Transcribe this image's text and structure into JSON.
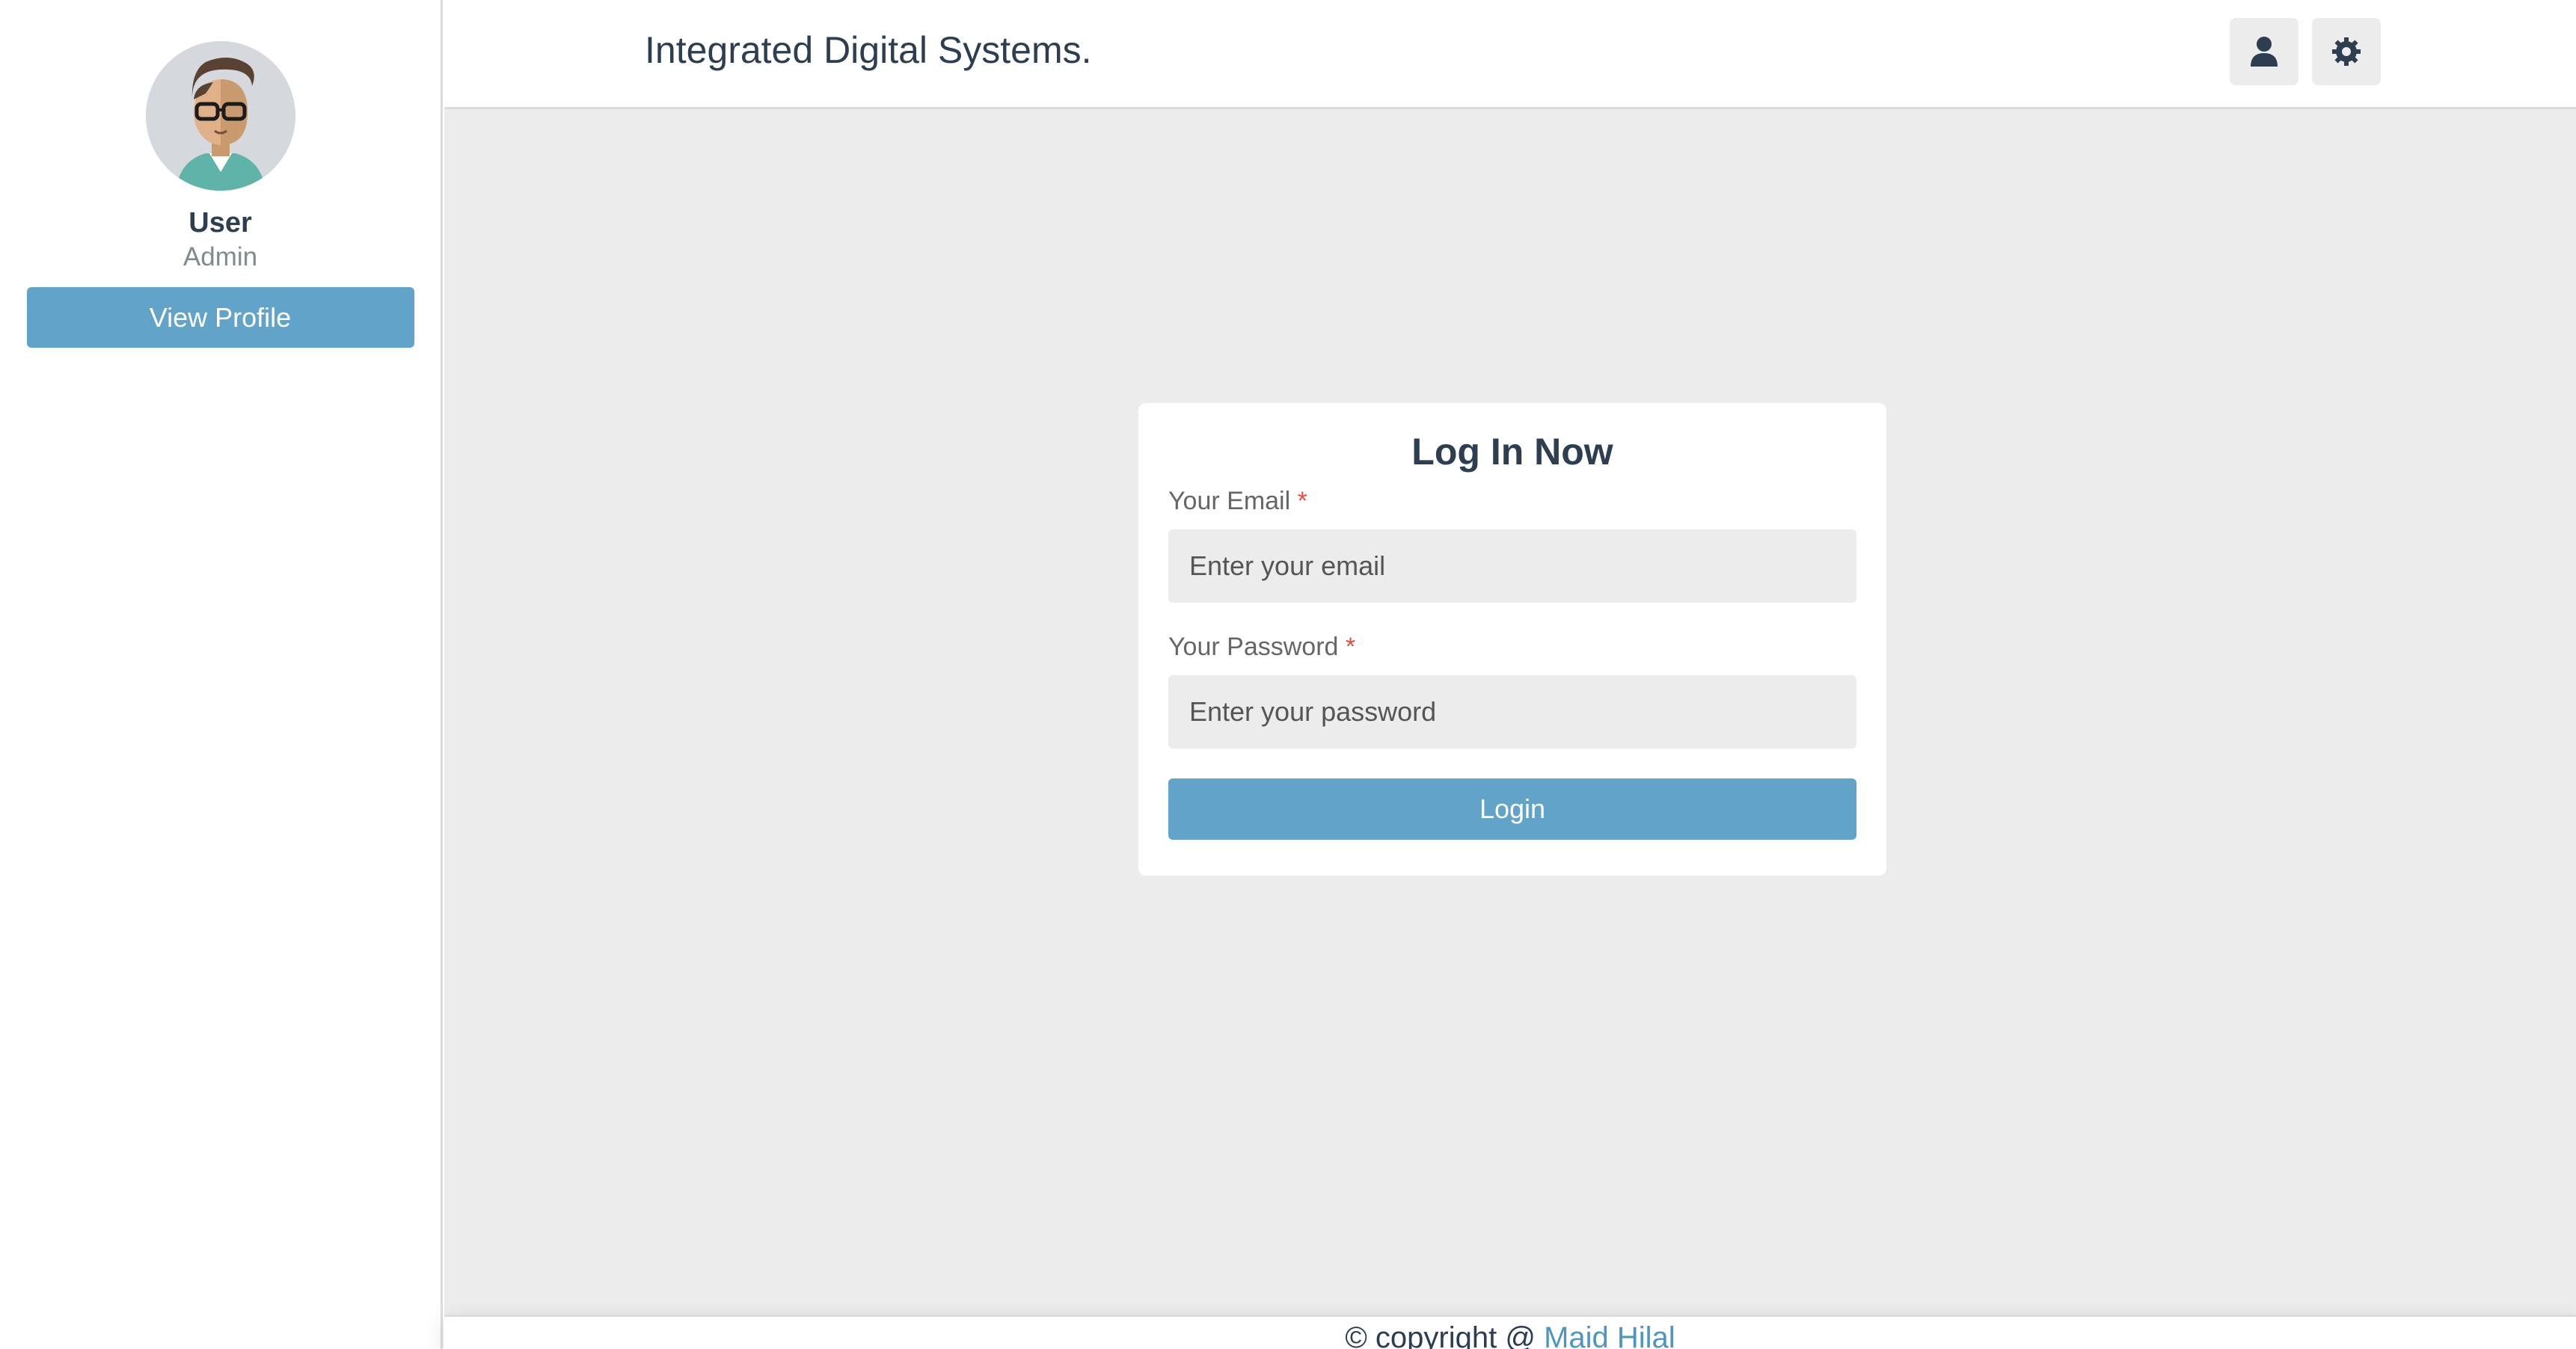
{
  "sidebar": {
    "profile": {
      "name": "User",
      "role": "Admin",
      "view_profile_label": "View Profile"
    }
  },
  "header": {
    "brand": "Integrated Digital Systems.",
    "icons": [
      "user-icon",
      "gear-icon"
    ]
  },
  "login": {
    "title": "Log In Now",
    "email_label": "Your Email",
    "email_placeholder": "Enter your email",
    "password_label": "Your Password",
    "password_placeholder": "Enter your password",
    "required_mark": "*",
    "submit_label": "Login"
  },
  "footer": {
    "copyright_text": "© copyright @ ",
    "author": "Maid Hilal"
  },
  "colors": {
    "accent": "#62a3c9",
    "background": "#ececec",
    "text": "#2c3e50",
    "required": "#e74c3c"
  }
}
